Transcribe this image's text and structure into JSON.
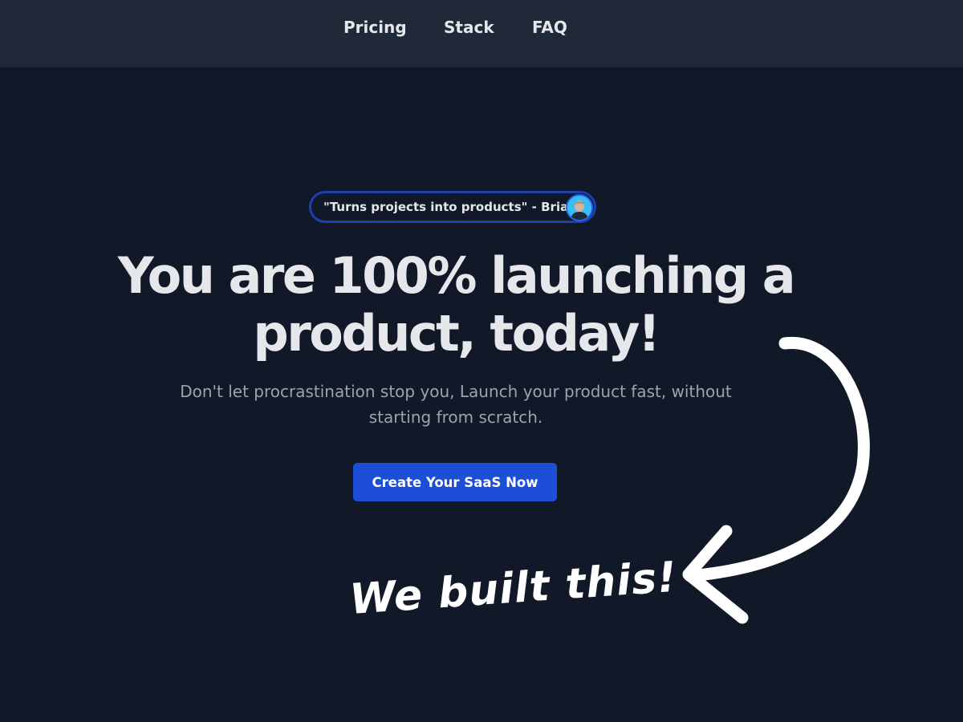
{
  "nav": {
    "items": [
      {
        "label": "Pricing"
      },
      {
        "label": "Stack"
      },
      {
        "label": "FAQ"
      }
    ]
  },
  "hero": {
    "testimonial": "\"Turns projects into products\" - Brian",
    "headline_line1": "You are 100% launching a",
    "headline_line2": "product, today!",
    "subtext_line1": "Don't let procrastination stop you, Launch your product fast, without",
    "subtext_line2": "starting from scratch.",
    "cta_label": "Create Your SaaS Now"
  },
  "annotation": {
    "note": "We built this!",
    "arrow_icon": "curved-arrow-icon"
  },
  "colors": {
    "background": "#111827",
    "nav_background": "#1f2937",
    "accent": "#1d4ed8",
    "text": "#e5e7eb",
    "muted_text": "#9ca3af"
  }
}
